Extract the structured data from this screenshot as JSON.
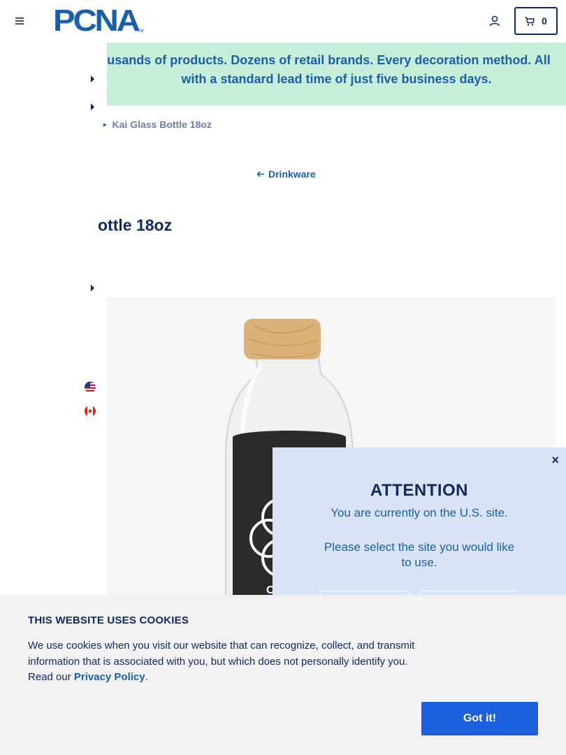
{
  "header": {
    "logo_text": "PCNA",
    "logo_tm": "TM",
    "cart_count": "0"
  },
  "promo": {
    "line1": "usands of products. Dozens of retail brands. Every decoration method. All",
    "line2": "with a standard lead time of just five business days."
  },
  "breadcrumb": {
    "current": "Kai Glass Bottle 18oz"
  },
  "back_link": {
    "label": "Drinkware"
  },
  "product": {
    "title_visible": "ottle 18oz",
    "lid_color": "#d9b27a",
    "sleeve_color": "#2b2b2b"
  },
  "attention": {
    "close": "×",
    "title": "ATTENTION",
    "current_site": "You are currently on the U.S. site.",
    "prompt": "Please select the site you would like to use."
  },
  "cookie": {
    "title": "THIS WEBSITE USES COOKIES",
    "body": "We use cookies when you visit our website that can recognize, collect, and transmit information that is associated with you, but which does not personally identify you. Read our ",
    "link": "Privacy Policy",
    "suffix": ".",
    "button": "Got it!"
  },
  "colors": {
    "brand_blue": "#1a5fa8",
    "navy": "#0f2a5c",
    "promo_bg": "#c6eed8",
    "cookie_button": "#1a5fdc",
    "modal_bg": "#d9e3f5"
  }
}
